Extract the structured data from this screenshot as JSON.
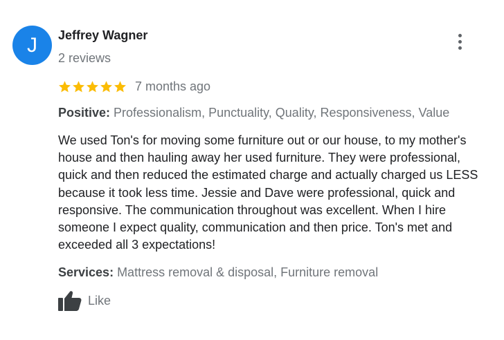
{
  "reviewer": {
    "initial": "J",
    "name": "Jeffrey Wagner",
    "review_count": "2 reviews",
    "avatar_color": "#1a83e8"
  },
  "menu": {
    "icon": "more-vert-icon"
  },
  "rating": {
    "stars": 5,
    "max_stars": 5,
    "star_color": "#fbbc04",
    "time_ago": "7 months ago"
  },
  "positive": {
    "label": "Positive:",
    "values": " Professionalism, Punctuality, Quality, Responsiveness, Value"
  },
  "review": {
    "text": "We used Ton's for moving some furniture out or our house, to my mother's house and then hauling away her used furniture.  They were professional, quick and then reduced the estimated charge and actually charged us LESS because it took less time.  Jessie and Dave were professional, quick and responsive.  The communication throughout was excellent.  When I hire someone I expect quality, communication and then price.  Ton's met and exceeded all 3 expectations!"
  },
  "services": {
    "label": "Services:",
    "values": " Mattress removal & disposal, Furniture removal"
  },
  "actions": {
    "like_label": "Like",
    "like_icon": "thumbs-up-icon"
  }
}
